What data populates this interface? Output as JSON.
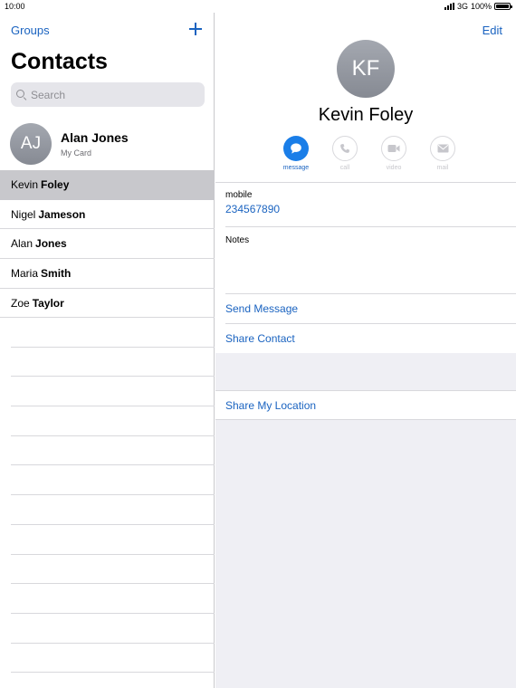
{
  "status_bar": {
    "time": "10:00",
    "network": "3G",
    "battery": "100%"
  },
  "sidebar": {
    "groups_label": "Groups",
    "title": "Contacts",
    "search_placeholder": "Search",
    "my_card": {
      "initials": "AJ",
      "name": "Alan Jones",
      "subtitle": "My Card"
    },
    "contacts": [
      {
        "first": "Kevin",
        "last": "Foley",
        "selected": true
      },
      {
        "first": "Nigel",
        "last": "Jameson",
        "selected": false
      },
      {
        "first": "Alan",
        "last": "Jones",
        "selected": false
      },
      {
        "first": "Maria",
        "last": "Smith",
        "selected": false
      },
      {
        "first": "Zoe",
        "last": "Taylor",
        "selected": false
      }
    ]
  },
  "detail": {
    "edit_label": "Edit",
    "initials": "KF",
    "name": "Kevin Foley",
    "actions": [
      {
        "label": "message",
        "icon": "message-icon",
        "enabled": true
      },
      {
        "label": "call",
        "icon": "phone-icon",
        "enabled": false
      },
      {
        "label": "video",
        "icon": "video-icon",
        "enabled": false
      },
      {
        "label": "mail",
        "icon": "mail-icon",
        "enabled": false
      }
    ],
    "phone_label": "mobile",
    "phone_value": "234567890",
    "notes_label": "Notes",
    "send_message": "Send Message",
    "share_contact": "Share Contact",
    "share_location": "Share My Location"
  },
  "colors": {
    "accent": "#1a63c0",
    "action_active": "#1a7ee8",
    "selected_row": "#c8c8cc",
    "background": "#efeff4"
  }
}
